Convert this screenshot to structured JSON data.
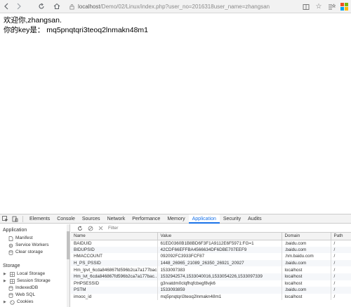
{
  "browser": {
    "url_host": "localhost",
    "url_path": "/Demo/02/Linux/index.php?user_no=2016318user_name=zhangsan",
    "icons": [
      "back-icon",
      "forward-icon",
      "reload-icon",
      "home-icon",
      "lock-icon",
      "reader-icon",
      "star-icon",
      "favorites-icon",
      "windows-icon"
    ]
  },
  "page": {
    "line1": "欢迎你,zhangsan.",
    "line2": "你的key是： mq5pnqtqri3teoq2lnmakn48m1"
  },
  "devtools": {
    "tabs": [
      "Elements",
      "Console",
      "Sources",
      "Network",
      "Performance",
      "Memory",
      "Application",
      "Security",
      "Audits"
    ],
    "active_tab": "Application",
    "sidebar": {
      "application_heading": "Application",
      "application_items": [
        "Manifest",
        "Service Workers",
        "Clear storage"
      ],
      "storage_heading": "Storage",
      "storage_items": [
        "Local Storage",
        "Session Storage",
        "IndexedDB",
        "Web SQL",
        "Cookies"
      ]
    },
    "filter_placeholder": "Filter",
    "table": {
      "headers": [
        "Name",
        "Value",
        "Domain",
        "Path"
      ],
      "rows": [
        [
          "BAIDUID",
          "61ED0360B1B8BD6F3F1A9112E6F5971:FG=1",
          ".baidu.com",
          "/"
        ],
        [
          "BIDUPSID",
          "42CDF66EFFBA4566634DF6DBE707EEF9",
          ".baidu.com",
          "/"
        ],
        [
          "HMACCOUNT",
          "092092FC3933FCF87",
          ".hm.baidu.com",
          "/"
        ],
        [
          "H_PS_PSSID",
          "1448_26965_21089_26350_26921_20927",
          ".baidu.com",
          "/"
        ],
        [
          "Hm_lpvt_6cda846867fd596b2ca7a177bac...",
          "1533097383",
          "localhost",
          "/"
        ],
        [
          "Hm_lvt_6cda846867fd596b2ca7a177bac...",
          "1532942574,1533040016,1533054226,1533097339",
          "localhost",
          "/"
        ],
        [
          "PHPSESSID",
          "g3rvatdm0clqfhqfcbegf8vjk6",
          "localhost",
          "/"
        ],
        [
          "PSTM",
          "1533093859",
          ".baidu.com",
          "/"
        ],
        [
          "imooc_id",
          "mq5pnqtqri3teoq2lnmakn48m1",
          "localhost",
          "/"
        ]
      ]
    }
  },
  "colors": {
    "accent": "#1a73e8",
    "toolbar_bg": "#f2f2f2",
    "devtools_bar_bg": "#f3f3f3"
  }
}
